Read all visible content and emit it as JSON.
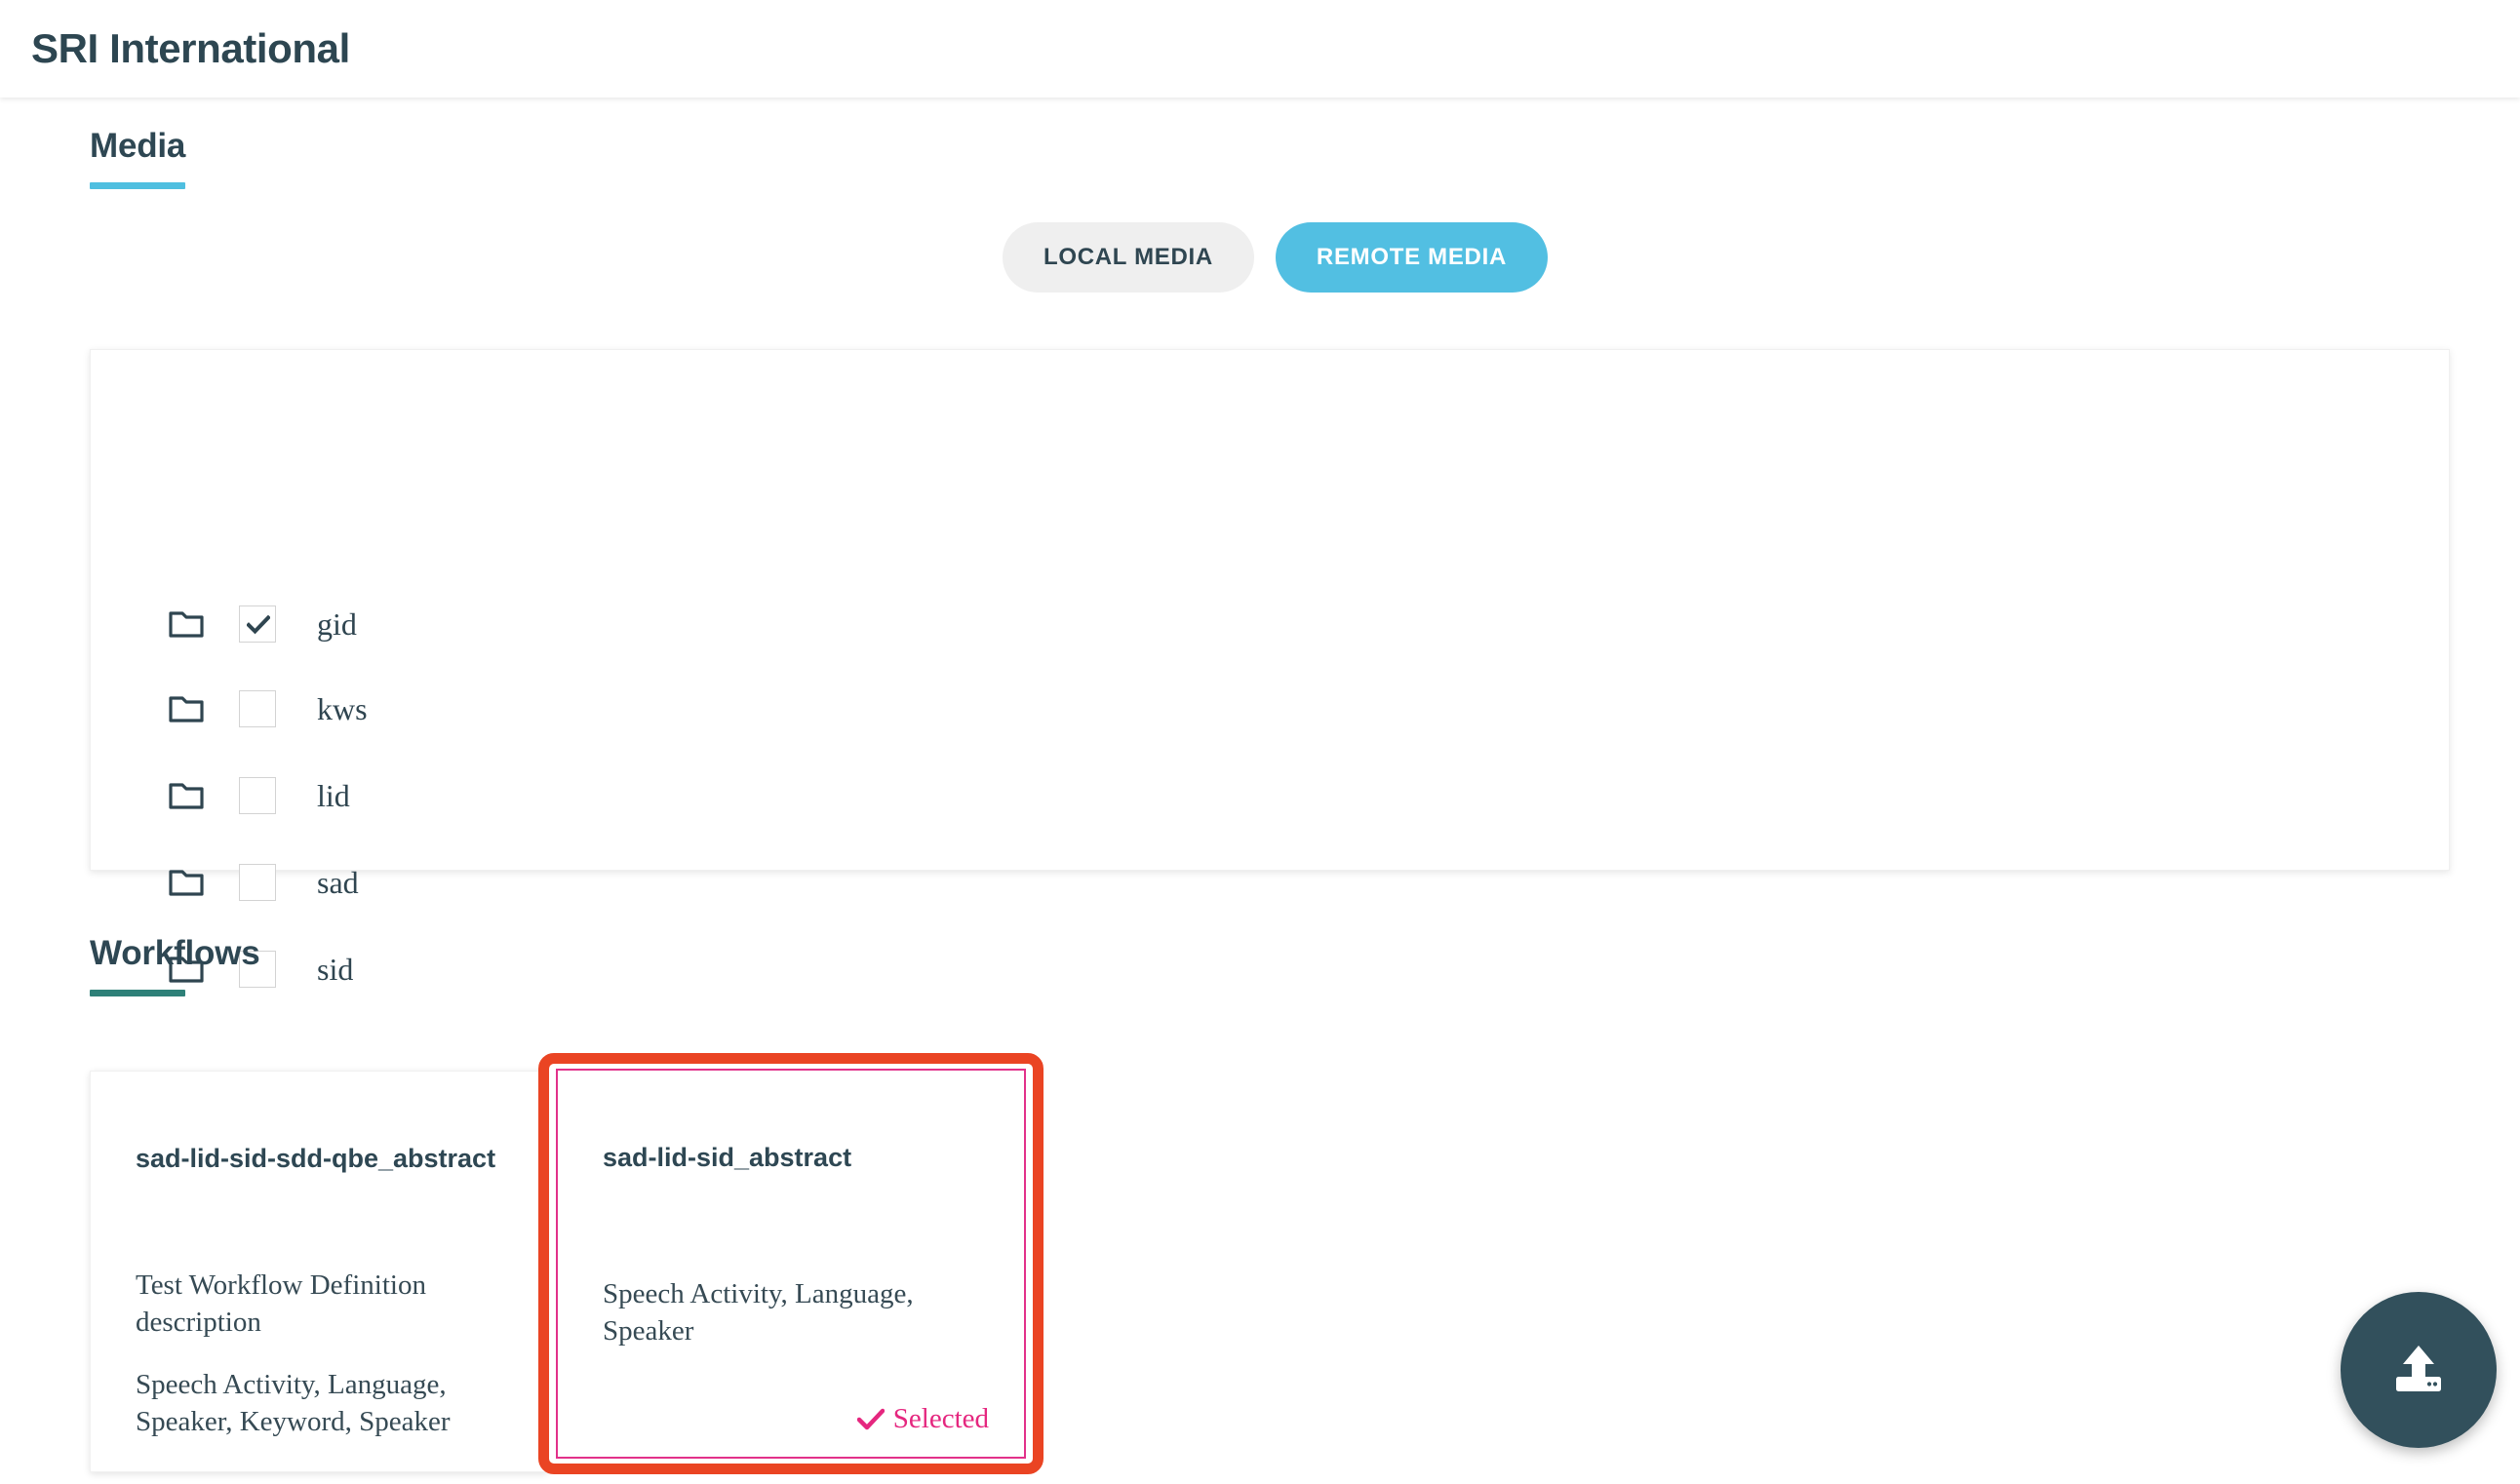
{
  "appbar": {
    "title": "SRI International"
  },
  "media": {
    "heading": "Media",
    "accent_color": "#4fbfe0",
    "tabs": [
      {
        "label": "LOCAL MEDIA",
        "active": false
      },
      {
        "label": "REMOTE MEDIA",
        "active": true
      }
    ],
    "folders": [
      {
        "name": "gid",
        "checked": true
      },
      {
        "name": "kws",
        "checked": false
      },
      {
        "name": "lid",
        "checked": false
      },
      {
        "name": "sad",
        "checked": false
      },
      {
        "name": "sid",
        "checked": false
      }
    ]
  },
  "workflows": {
    "heading": "Workflows",
    "accent_color": "#2e8078",
    "cards": [
      {
        "title": "sad-lid-sid-sdd-qbe_abstract",
        "description": "Test Workflow Definition description",
        "tags": "Speech Activity, Language, Speaker, Keyword, Speaker",
        "selected": false
      },
      {
        "title": "sad-lid-sid_abstract",
        "description": "",
        "tags": "Speech Activity, Language, Speaker",
        "selected": true,
        "selected_label": "Selected",
        "highlight_color": "#ea4423",
        "border_color": "#e2318a",
        "selected_text_color": "#e5277f"
      }
    ]
  },
  "fab": {
    "icon": "upload-icon",
    "color": "#32505c"
  }
}
